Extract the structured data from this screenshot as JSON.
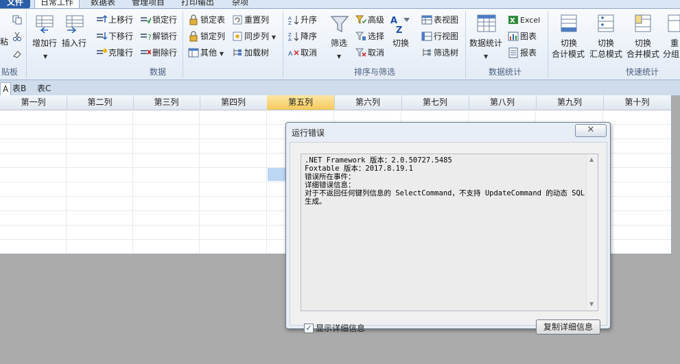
{
  "ribbon": {
    "tabs": [
      "文件",
      "日常工作",
      "数据表",
      "管理项目",
      "打印输出",
      "杂项"
    ],
    "clipboard": {
      "paste": "粘",
      "group": "贴板"
    },
    "rows": {
      "add_row": "增加行",
      "insert_row": "插入行",
      "move_up": "上移行",
      "move_down": "下移行",
      "clone_row": "克隆行",
      "lock_row": "锁定行",
      "unlock_row": "解锁行",
      "delete_row": "删除行",
      "lock_table": "锁定表",
      "lock_column": "锁定列",
      "other": "其他",
      "reset_column": "重置列",
      "sync_column": "同步列",
      "load_tree": "加载树",
      "group": "数据"
    },
    "sort": {
      "asc": "升序",
      "desc": "降序",
      "cancel": "取消",
      "filter": "筛选",
      "advanced": "高级",
      "select": "选择",
      "cancel2": "取消",
      "toggle": "切换",
      "group": "排序与筛选"
    },
    "views": {
      "table_view": "表视图",
      "row_view": "行视图",
      "filter_tree": "筛选树"
    },
    "stats": {
      "data_stats": "数据统计",
      "excel": "Excel",
      "chart": "图表",
      "report": "报表",
      "group": "数据统计"
    },
    "quick": {
      "switch1_a": "切换",
      "switch1_b": "合计模式",
      "switch2_a": "切换",
      "switch2_b": "汇总模式",
      "switch3_a": "切换",
      "switch3_b": "合并模式",
      "switch4_a": "重",
      "switch4_b": "分组",
      "group": "快速统计"
    }
  },
  "sheet_tabs": [
    "A",
    "表B",
    "表C"
  ],
  "columns": [
    "第一列",
    "第二列",
    "第三列",
    "第四列",
    "第五列",
    "第六列",
    "第七列",
    "第八列",
    "第九列",
    "第十列"
  ],
  "dialog": {
    "title": "运行错误",
    "close": "✕",
    "lines": [
      ".NET Framework 版本：2.0.50727.5485",
      "Foxtable 版本：2017.8.19.1",
      "错误所在事件：",
      "详细错误信息：",
      "对于不返回任何键列信息的 SelectCommand，不支持 UpdateCommand 的动态 SQL 生成。"
    ],
    "show_details": "显示详细信息",
    "show_details_checked": true,
    "copy_button": "复制详细信息"
  },
  "colors": {
    "accent": "#2a5ea8",
    "selected_header": "#f6c95a",
    "selected_cell": "#bcd6f5"
  }
}
